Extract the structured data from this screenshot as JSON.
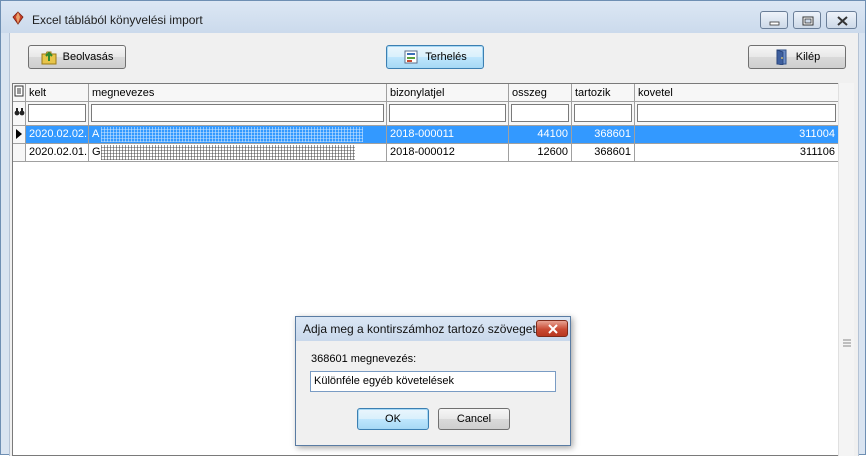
{
  "window": {
    "title": "Excel táblából könyvelési import"
  },
  "toolbar": {
    "read_label": "Beolvasás",
    "post_label": "Terhelés",
    "exit_label": "Kilép"
  },
  "grid": {
    "columns": [
      "kelt",
      "megnevezes",
      "bizonylatjel",
      "osszeg",
      "tartozik",
      "kovetel"
    ],
    "rows": [
      {
        "kelt": "2020.02.02.",
        "megnevezes": "A",
        "bizonylatjel": "2018-000011",
        "osszeg": "44100",
        "tartozik": "368601",
        "kovetel": "311004",
        "selected": true
      },
      {
        "kelt": "2020.02.01.",
        "megnevezes": "G",
        "bizonylatjel": "2018-000012",
        "osszeg": "12600",
        "tartozik": "368601",
        "kovetel": "311106",
        "selected": false
      }
    ]
  },
  "dialog": {
    "title": "Adja meg a kontirszámhoz tartozó szöveget",
    "label": "368601 megnevezés:",
    "input_value": "Különféle egyéb követelések",
    "ok_label": "OK",
    "cancel_label": "Cancel"
  },
  "colors": {
    "selection": "#3399ff",
    "titlebar": "#cbdaec",
    "close_button": "#c94b34"
  }
}
